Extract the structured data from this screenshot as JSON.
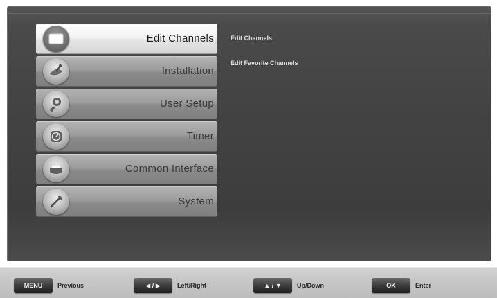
{
  "menu": {
    "items": [
      {
        "label": "Edit Channels",
        "icon": "tv-screen-icon",
        "selected": true
      },
      {
        "label": "Installation",
        "icon": "satellite-dish-icon",
        "selected": false
      },
      {
        "label": "User Setup",
        "icon": "user-icon",
        "selected": false
      },
      {
        "label": "Timer",
        "icon": "clock-icon",
        "selected": false
      },
      {
        "label": "Common Interface",
        "icon": "ci-card-icon",
        "selected": false
      },
      {
        "label": "System",
        "icon": "wrench-icon",
        "selected": false
      }
    ]
  },
  "submenu": {
    "items": [
      {
        "label": "Edit Channels"
      },
      {
        "label": "Edit Favorite Channels"
      }
    ]
  },
  "footer": {
    "hints": [
      {
        "key": "MENU",
        "desc": "Previous"
      },
      {
        "key": "◀ / ▶",
        "desc": "Left/Right"
      },
      {
        "key": "▲ / ▼",
        "desc": "Up/Down"
      },
      {
        "key": "OK",
        "desc": "Enter"
      }
    ]
  }
}
